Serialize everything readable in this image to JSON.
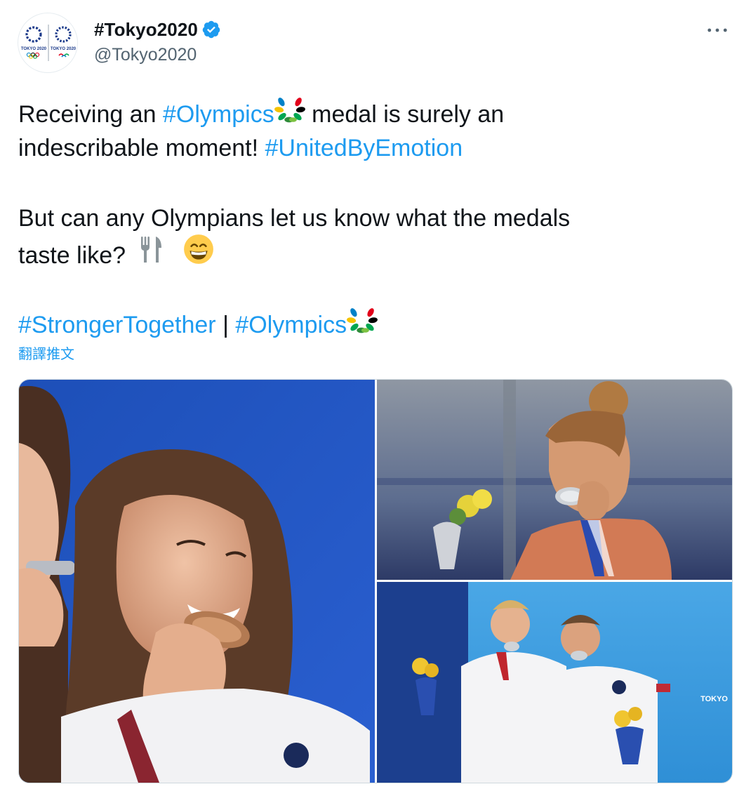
{
  "tweet": {
    "author": {
      "display_name": "#Tokyo2020",
      "handle": "@Tokyo2020",
      "verified": true,
      "avatar_text_left": "TOKYO 2020",
      "avatar_text_right": "TOKYO 2020"
    },
    "text": {
      "line1": {
        "pre": "Receiving an ",
        "tag1": "#Olympics",
        "post": " medal is surely an"
      },
      "line2": {
        "pre": "indescribable moment! ",
        "tag": "#UnitedByEmotion"
      },
      "line3": "But can any Olympians let us know what the medals",
      "line4": "taste like?",
      "line5": {
        "tag1": "#StrongerTogether",
        "sep": " | ",
        "tag2": "#Olympics"
      }
    },
    "translate_label": "翻譯推文",
    "icons": {
      "more": "more-horizontal-icon",
      "verified": "verified-badge-icon",
      "laurel": "olympic-laurel-emoji",
      "fork_knife": "fork-and-knife-emoji",
      "grin": "grinning-face-emoji"
    },
    "photos": [
      {
        "name": "swimmer-biting-bronze-medal"
      },
      {
        "name": "athlete-biting-silver-medal"
      },
      {
        "name": "divers-biting-silver-medals",
        "banner_text": "TOKYO"
      }
    ],
    "colors": {
      "link": "#1d9bf0",
      "verified": "#1d9bf0",
      "secondary_text": "#536471"
    }
  }
}
